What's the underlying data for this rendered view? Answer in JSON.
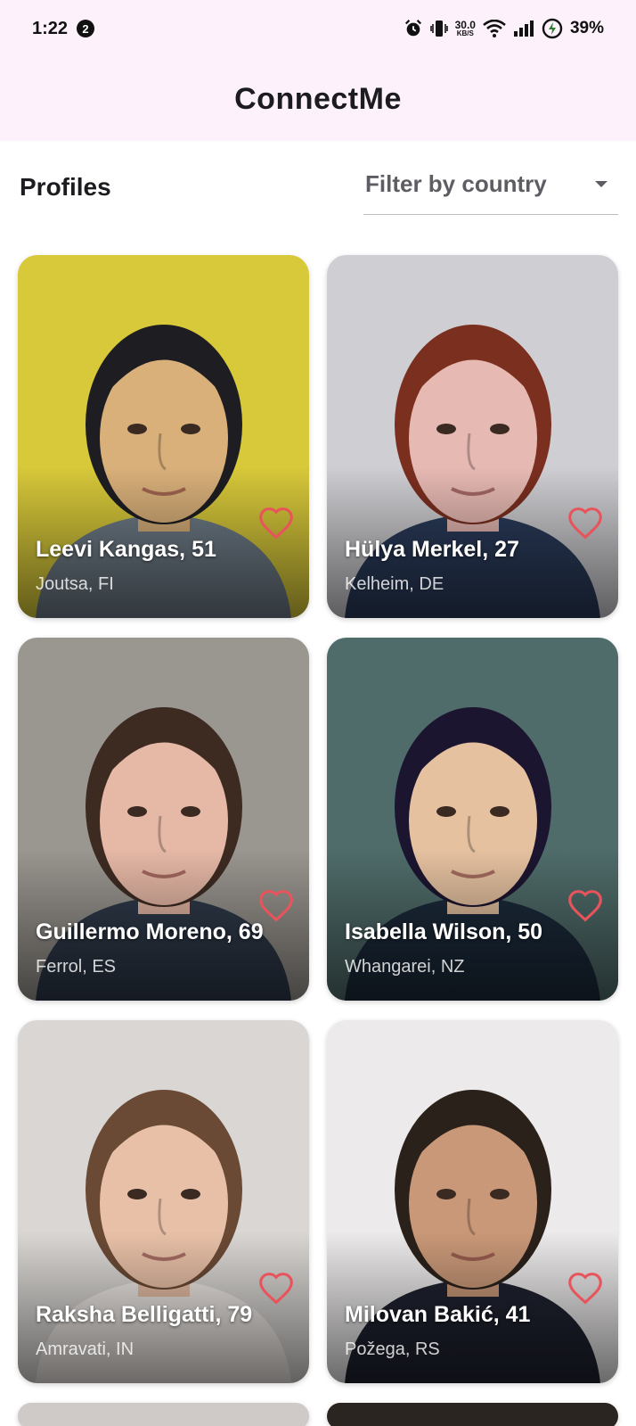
{
  "status_bar": {
    "time": "1:22",
    "notification_count": "2",
    "net_speed_value": "30.0",
    "net_speed_unit": "KB/S",
    "battery": "39%"
  },
  "app_bar": {
    "title": "ConnectMe"
  },
  "toolbar": {
    "section_title": "Profiles",
    "filter_label": "Filter by country"
  },
  "profiles": [
    {
      "name": "Leevi Kangas, 51",
      "location": "Joutsa, FI",
      "bg": "#d8c93a",
      "skin": "#d9b07a",
      "hair": "#1e1e22",
      "shirt": "#6e7b86"
    },
    {
      "name": "Hülya Merkel, 27",
      "location": "Kelheim, DE",
      "bg": "#cfcfd3",
      "skin": "#e7b9b3",
      "hair": "#7a2f1f",
      "shirt": "#2a3b5a"
    },
    {
      "name": "Guillermo Moreno, 69",
      "location": "Ferrol, ES",
      "bg": "#9a9690",
      "skin": "#e6b8a6",
      "hair": "#3d2b22",
      "shirt": "#2f3a4a"
    },
    {
      "name": "Isabella Wilson, 50",
      "location": "Whangarei, NZ",
      "bg": "#4f6c6a",
      "skin": "#e5c1a0",
      "hair": "#1c1530",
      "shirt": "#1b2a3a"
    },
    {
      "name": "Raksha Belligatti, 79",
      "location": "Amravati, IN",
      "bg": "#d9d6d3",
      "skin": "#e8c0a7",
      "hair": "#6b4a35",
      "shirt": "#efe9e5"
    },
    {
      "name": "Milovan Bakić, 41",
      "location": "Požega, RS",
      "bg": "#eceaea",
      "skin": "#c99878",
      "hair": "#2b211b",
      "shirt": "#1f2230"
    }
  ],
  "partial_cards": [
    {
      "bg": "#cfcac8"
    },
    {
      "bg": "#2b2522"
    }
  ]
}
